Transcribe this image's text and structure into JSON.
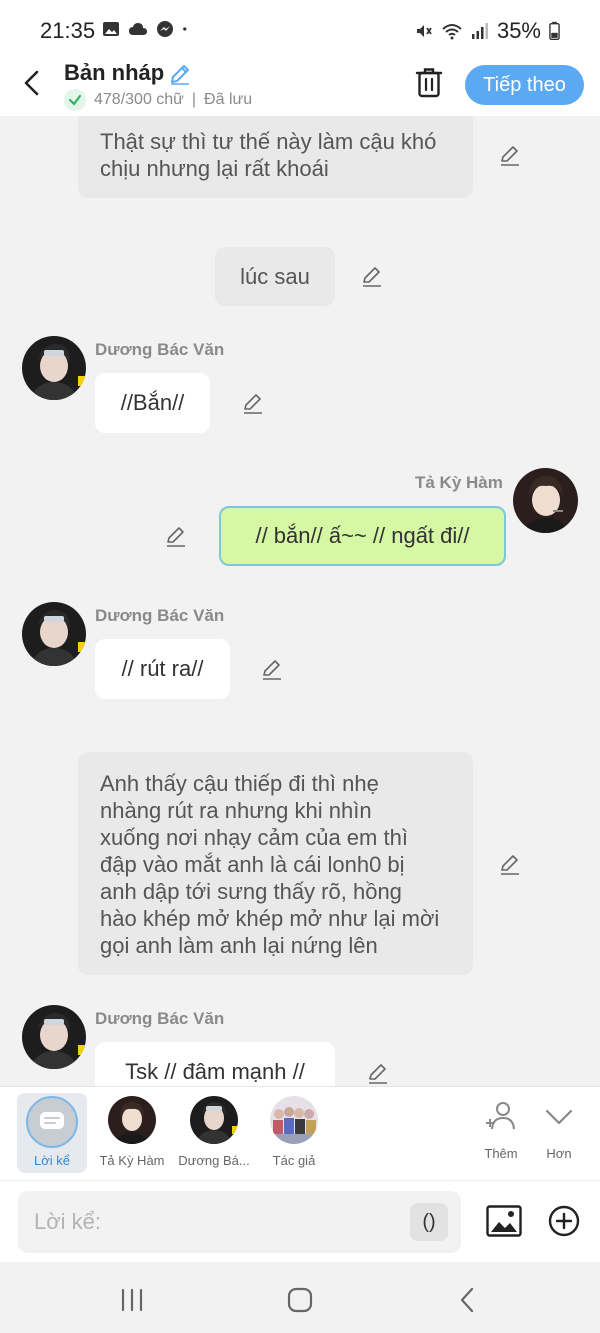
{
  "status_bar": {
    "time": "21:35",
    "battery": "35%"
  },
  "header": {
    "title": "Bản nháp",
    "word_count": "478/300 chữ",
    "separator": "|",
    "saved": "Đã lưu",
    "next_label": "Tiếp theo"
  },
  "messages": [
    {
      "type": "narration",
      "text": "Thật sự thì tư thế này làm cậu khó chịu nhưng lại rất khoái"
    },
    {
      "type": "narration",
      "text": "lúc sau"
    },
    {
      "type": "char_left",
      "speaker": "Dương Bác Văn",
      "text": "//Bắn//"
    },
    {
      "type": "char_right",
      "speaker": "Tả Kỳ Hàm",
      "text": "// bắn// ấ~~ // ngất đi//"
    },
    {
      "type": "char_left",
      "speaker": "Dương Bác Văn",
      "text": "// rút ra//"
    },
    {
      "type": "narration",
      "lines": [
        "Anh thấy cậu thiếp đi thì nhẹ",
        "nhàng rút ra nhưng khi nhìn",
        "xuống nơi nhạy cảm của em thì",
        "đập vào mắt anh là cái lonh0 bị",
        "anh dập tới sưng thấy rõ, hồng",
        "hào khép mở khép mở như lại mời",
        "gọi anh làm anh lại nứng lên"
      ]
    },
    {
      "type": "char_left",
      "speaker": "Dương Bác Văn",
      "text": "Tsk // đâm mạnh //"
    }
  ],
  "characters": {
    "narrator_label": "Lời kể",
    "items": [
      {
        "label": "Tả Kỳ Hàm"
      },
      {
        "label": "Dương Bá..."
      },
      {
        "label": "Tác giả"
      }
    ],
    "add_label": "Thêm",
    "more_label": "Hơn"
  },
  "input": {
    "placeholder": "Lời kể:",
    "paren_label": "()"
  },
  "colors": {
    "accent": "#5aa9f2",
    "narration_bg": "#e9e9e9",
    "user_bubble": "#d6f7a4",
    "user_bubble_border": "#7cc7dd"
  }
}
